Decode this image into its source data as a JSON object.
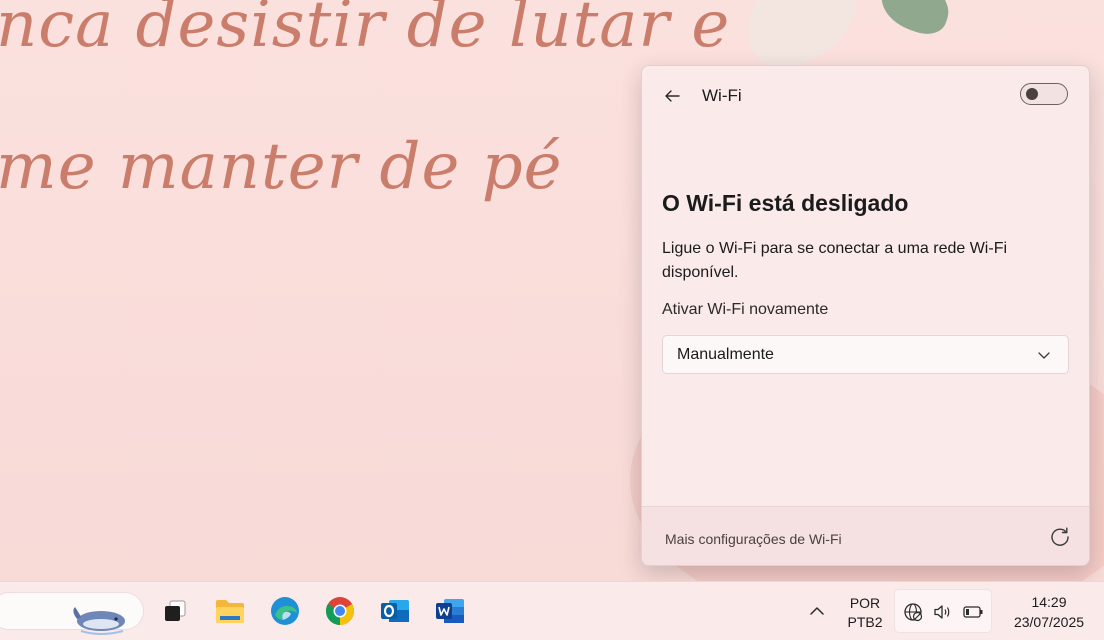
{
  "wallpaper": {
    "quote_line_1": "nca desistir de lutar e",
    "quote_line_2": "me manter de pé",
    "text_color": "#c97d6a"
  },
  "wifi_flyout": {
    "title": "Wi-Fi",
    "toggle_state": "off",
    "status_title": "O Wi-Fi está desligado",
    "status_description": "Ligue o Wi-Fi para se conectar a uma rede Wi-Fi disponível.",
    "reenable_label": "Ativar Wi-Fi novamente",
    "reenable_selected": "Manualmente",
    "more_settings_link": "Mais configurações de Wi-Fi",
    "icons": [
      "back-arrow-icon",
      "toggle-switch",
      "chevron-down-icon",
      "refresh-icon"
    ]
  },
  "taskbar": {
    "apps": [
      "search",
      "task-view",
      "file-explorer",
      "edge",
      "chrome",
      "outlook",
      "word"
    ],
    "tray": {
      "language_line1": "POR",
      "language_line2": "PTB2",
      "time": "14:29",
      "date": "23/07/2025",
      "icons": [
        "chevron-up-icon",
        "globe-no-internet-icon",
        "volume-icon",
        "battery-icon"
      ]
    }
  },
  "colors": {
    "flyout_bg": "#fbeaea",
    "taskbar_bg": "#fbeaea",
    "desktop_bg": "#f9dcda"
  }
}
